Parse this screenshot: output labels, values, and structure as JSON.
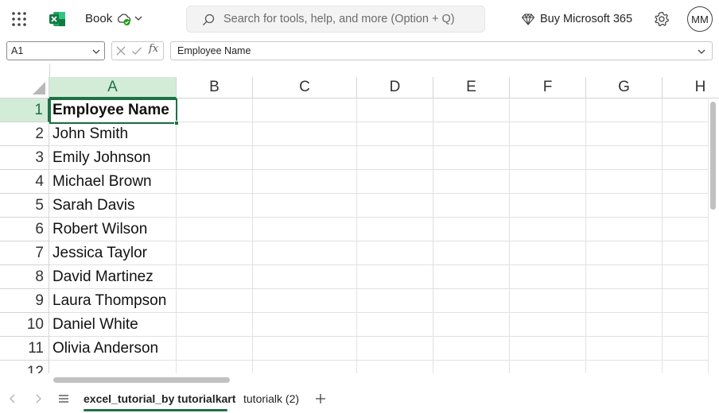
{
  "titlebar": {
    "book_name": "Book",
    "search_placeholder": "Search for tools, help, and more (Option + Q)",
    "buy_label": "Buy Microsoft 365",
    "avatar_initials": "MM"
  },
  "formula_bar": {
    "name_box": "A1",
    "fx_label": "fx",
    "formula_value": "Employee Name"
  },
  "grid": {
    "columns": [
      "A",
      "B",
      "C",
      "D",
      "E",
      "F",
      "G",
      "H"
    ],
    "rows": [
      "1",
      "2",
      "3",
      "4",
      "5",
      "6",
      "7",
      "8",
      "9",
      "10",
      "11",
      "12"
    ],
    "column_a": [
      "Employee Name",
      "John Smith",
      "Emily Johnson",
      "Michael Brown",
      "Sarah Davis",
      "Robert Wilson",
      "Jessica Taylor",
      "David Martinez",
      "Laura Thompson",
      "Daniel White",
      "Olivia Anderson",
      ""
    ],
    "selected_cell": "A1"
  },
  "sheets": {
    "tabs": [
      "excel_tutorial_by tutorialkart",
      "tutorialk (2)"
    ],
    "active_index": 0
  },
  "colors": {
    "accent": "#1e7145",
    "selected_header_bg": "#d2ecd8",
    "excel_brand": "#107c41"
  },
  "icons": {
    "app_launcher": "waffle-icon",
    "app": "excel-logo-icon",
    "save_status": "cloud-sync-icon",
    "search": "search-icon",
    "premium": "diamond-icon",
    "settings": "gear-icon"
  }
}
